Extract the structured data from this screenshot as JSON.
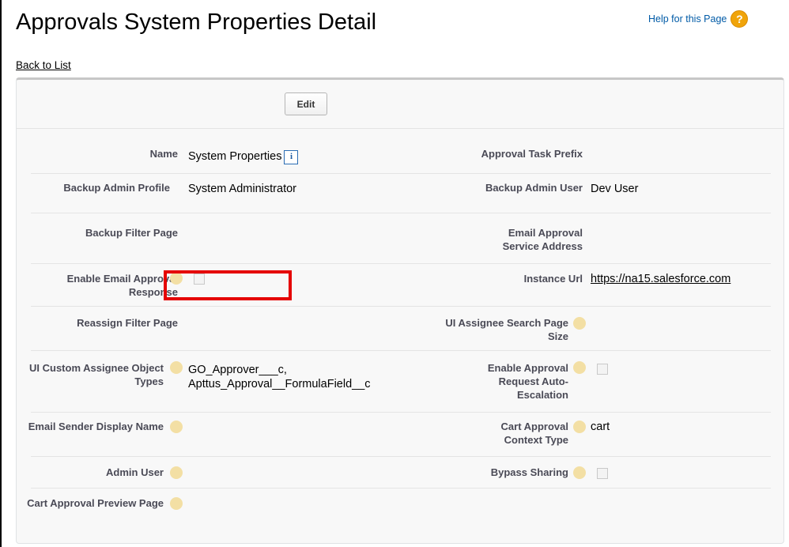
{
  "header": {
    "title": "Approvals System Properties Detail",
    "help_text": "Help for this Page",
    "help_icon": "question-icon",
    "back_link": "Back to List"
  },
  "toolbar": {
    "edit_label": "Edit"
  },
  "fields": {
    "name": {
      "label": "Name",
      "value": "System Properties",
      "info_icon": "i"
    },
    "approval_task_prefix": {
      "label": "Approval Task Prefix",
      "value": ""
    },
    "backup_admin_profile": {
      "label": "Backup Admin Profile",
      "value": "System Administrator"
    },
    "backup_admin_user": {
      "label": "Backup Admin User",
      "value": "Dev User"
    },
    "backup_filter_page": {
      "label": "Backup Filter Page",
      "value": ""
    },
    "email_approval_service_address": {
      "label": "Email Approval Service Address",
      "value": ""
    },
    "enable_email_approval_response": {
      "label": "Enable Email Approval Response",
      "checked": false
    },
    "instance_url": {
      "label": "Instance Url",
      "value": "https://na15.salesforce.com"
    },
    "reassign_filter_page": {
      "label": "Reassign Filter Page",
      "value": ""
    },
    "ui_assignee_search_page_size": {
      "label": "UI Assignee Search Page Size",
      "value": ""
    },
    "ui_custom_assignee_object_types": {
      "label": "UI Custom Assignee Object Types",
      "value_line1": "GO_Approver___c,",
      "value_line2": "Apttus_Approval__FormulaField__c"
    },
    "enable_approval_request_auto_escalation": {
      "label": "Enable Approval Request Auto-Escalation",
      "checked": false
    },
    "email_sender_display_name": {
      "label": "Email Sender Display Name",
      "value": ""
    },
    "cart_approval_context_type": {
      "label": "Cart Approval Context Type",
      "value": "cart"
    },
    "admin_user": {
      "label": "Admin User",
      "value": ""
    },
    "bypass_sharing": {
      "label": "Bypass Sharing",
      "checked": false
    },
    "cart_approval_preview_page": {
      "label": "Cart Approval Preview Page",
      "value": ""
    }
  },
  "colors": {
    "label_text": "#4a4a56",
    "link": "#015ba7",
    "highlight": "#e50000",
    "help_icon": "#f0a40a",
    "hint_icon": "#f3dfa4"
  }
}
